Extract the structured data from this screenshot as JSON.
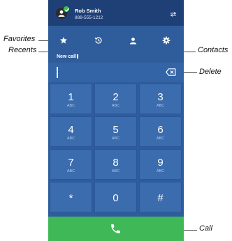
{
  "header": {
    "name": "Rob Smith",
    "phone": "888-555-1212"
  },
  "input": {
    "label": "New call",
    "value": ""
  },
  "keypad": [
    {
      "digit": "1",
      "letters": "ABC"
    },
    {
      "digit": "2",
      "letters": "ABC"
    },
    {
      "digit": "3",
      "letters": "ABC"
    },
    {
      "digit": "4",
      "letters": "ABC"
    },
    {
      "digit": "5",
      "letters": "ABC"
    },
    {
      "digit": "6",
      "letters": "ABC"
    },
    {
      "digit": "7",
      "letters": "ABC"
    },
    {
      "digit": "8",
      "letters": "ABC"
    },
    {
      "digit": "9",
      "letters": "ABC"
    },
    {
      "digit": "*",
      "letters": ""
    },
    {
      "digit": "0",
      "letters": ""
    },
    {
      "digit": "#",
      "letters": ""
    }
  ],
  "annotations": {
    "favorites": "Favorites",
    "recents": "Recents",
    "contacts": "Contacts",
    "delete": "Delete",
    "call": "Call"
  },
  "colors": {
    "header": "#1f3f77",
    "body": "#2f5d9b",
    "key": "#3a6cae",
    "call": "#3fb958",
    "status": "#37c24b"
  }
}
